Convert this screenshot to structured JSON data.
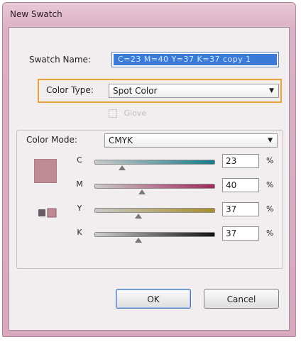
{
  "window": {
    "title": "New Swatch"
  },
  "swatch_name": {
    "label": "Swatch Name:",
    "value": "C=23 M=40 Y=37 K=37 copy 1"
  },
  "color_type": {
    "label": "Color Type:",
    "value": "Spot Color"
  },
  "global_checkbox_label": "Glove",
  "color_mode": {
    "label": "Color Mode:",
    "value": "CMYK"
  },
  "preview_color": "#c08a92",
  "channels": [
    {
      "label": "C",
      "value": "23",
      "unit": "%",
      "fraction": 0.23,
      "gradient": [
        "#c9c9c9",
        "#1a7a8a"
      ]
    },
    {
      "label": "M",
      "value": "40",
      "unit": "%",
      "fraction": 0.4,
      "gradient": [
        "#c9c9c9",
        "#a4285d"
      ]
    },
    {
      "label": "Y",
      "value": "37",
      "unit": "%",
      "fraction": 0.37,
      "gradient": [
        "#c9c9c9",
        "#a88e2a"
      ]
    },
    {
      "label": "K",
      "value": "37",
      "unit": "%",
      "fraction": 0.37,
      "gradient": [
        "#d0d0d0",
        "#111111"
      ]
    }
  ],
  "buttons": {
    "ok": "OK",
    "cancel": "Cancel"
  },
  "colors": {
    "highlight": "#f0a03a",
    "selection": "#3b7bd8"
  }
}
